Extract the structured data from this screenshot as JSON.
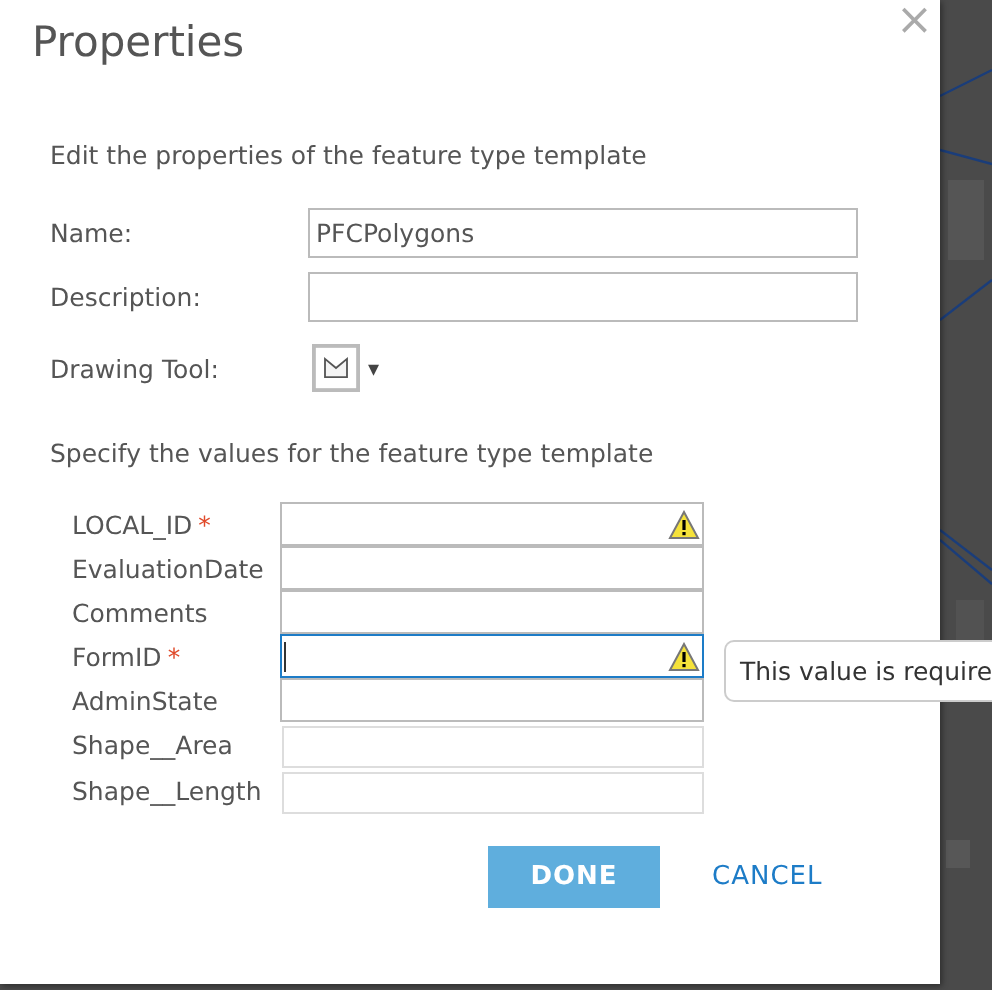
{
  "dialog": {
    "title": "Properties",
    "close": "×",
    "intro": "Edit the properties of the feature type template",
    "fields": [
      {
        "label": "Name:",
        "value": "PFCPolygons"
      },
      {
        "label": "Description:"
      }
    ],
    "drawing_tool": {
      "label": "Drawing Tool:",
      "caret": "▾"
    },
    "values_heading": "Specify the values for the feature type template",
    "attributes": [
      {
        "label": "LOCAL_ID",
        "required_mark": "*",
        "warning": true,
        "focused": false,
        "disabled": false
      },
      {
        "label": "EvaluationDate",
        "warning": false,
        "focused": false,
        "disabled": false
      },
      {
        "label": "Comments",
        "warning": false,
        "focused": false,
        "disabled": false
      },
      {
        "label": "FormID",
        "required_mark": "*",
        "warning": true,
        "focused": true,
        "disabled": false
      },
      {
        "label": "AdminState",
        "warning": false,
        "focused": false,
        "disabled": false
      },
      {
        "label": "Shape__Area",
        "warning": false,
        "focused": false,
        "disabled": true
      },
      {
        "label": "Shape__Length",
        "warning": false,
        "focused": false,
        "disabled": true
      }
    ],
    "tooltip": "This value is require",
    "buttons": [
      {
        "label": "DONE",
        "kind": "primary"
      },
      {
        "label": "CANCEL",
        "kind": "link"
      }
    ]
  }
}
